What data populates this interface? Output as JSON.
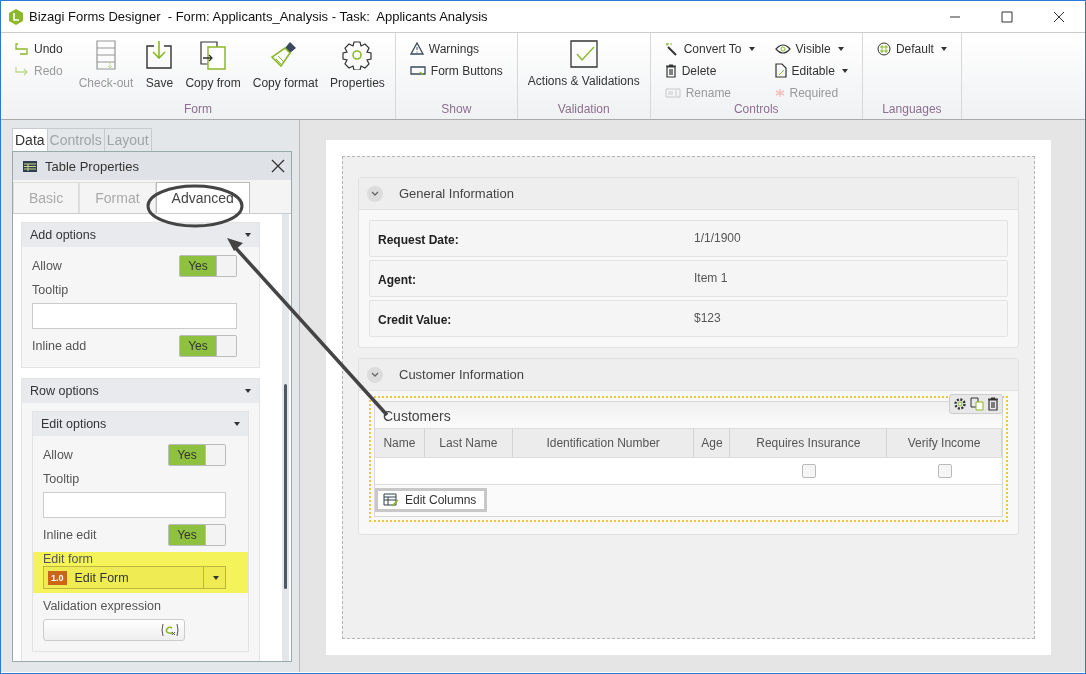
{
  "window": {
    "title": "Bizagi Forms Designer  - Form: Applicants_Analysis - Task:  Applicants Analysis"
  },
  "ribbon": {
    "groups": [
      {
        "label": "Form",
        "items": [
          {
            "kind": "small",
            "label": "Undo",
            "disabled": false,
            "dropdown": false
          },
          {
            "kind": "small",
            "label": "Redo",
            "disabled": true,
            "dropdown": false
          },
          {
            "kind": "large",
            "label": "Check-out",
            "disabled": true,
            "dropdown": false
          },
          {
            "kind": "large",
            "label": "Save",
            "disabled": false,
            "dropdown": false
          },
          {
            "kind": "large",
            "label": "Copy from",
            "disabled": false,
            "dropdown": false
          },
          {
            "kind": "large",
            "label": "Copy format",
            "disabled": false,
            "dropdown": false
          },
          {
            "kind": "large",
            "label": "Properties",
            "disabled": false,
            "dropdown": false
          }
        ]
      },
      {
        "label": "Show",
        "items": [
          {
            "kind": "small",
            "label": "Warnings",
            "disabled": false,
            "dropdown": false
          },
          {
            "kind": "small",
            "label": "Form Buttons",
            "disabled": false,
            "dropdown": false
          }
        ]
      },
      {
        "label": "Validation",
        "items": [
          {
            "kind": "large",
            "label": "Actions & Validations",
            "disabled": false,
            "dropdown": false
          }
        ]
      },
      {
        "label": "Controls",
        "items": [
          {
            "kind": "small",
            "label": "Convert To",
            "disabled": false,
            "dropdown": true
          },
          {
            "kind": "small",
            "label": "Delete",
            "disabled": false,
            "dropdown": false
          },
          {
            "kind": "small",
            "label": "Rename",
            "disabled": true,
            "dropdown": false
          },
          {
            "kind": "small",
            "label": "Visible",
            "disabled": false,
            "dropdown": true
          },
          {
            "kind": "small",
            "label": "Editable",
            "disabled": false,
            "dropdown": true
          },
          {
            "kind": "small",
            "label": "Required",
            "disabled": true,
            "dropdown": false
          }
        ]
      },
      {
        "label": "Languages",
        "items": [
          {
            "kind": "small",
            "label": "Default",
            "disabled": false,
            "dropdown": true
          }
        ]
      }
    ]
  },
  "side_panel": {
    "tabs": [
      {
        "label": "Data",
        "selected": true
      },
      {
        "label": "Controls",
        "selected": false
      },
      {
        "label": "Layout",
        "selected": false
      }
    ],
    "properties": {
      "title": "Table Properties",
      "tabs": [
        {
          "label": "Basic",
          "selected": false
        },
        {
          "label": "Format",
          "selected": false
        },
        {
          "label": "Advanced",
          "selected": true
        }
      ],
      "sections": [
        {
          "title": "Add options",
          "fields": [
            {
              "kind": "toggle",
              "label": "Allow",
              "value": "Yes",
              "on": true
            },
            {
              "kind": "text",
              "label": "Tooltip"
            },
            {
              "kind": "toggle",
              "label": "Inline add",
              "value": "Yes",
              "on": true
            }
          ]
        },
        {
          "title": "Row options",
          "subsections": [
            {
              "title": "Edit options",
              "fields": [
                {
                  "kind": "toggle",
                  "label": "Allow",
                  "value": "Yes",
                  "on": true
                },
                {
                  "kind": "text",
                  "label": "Tooltip"
                },
                {
                  "kind": "toggle",
                  "label": "Inline edit",
                  "value": "Yes",
                  "on": true
                },
                {
                  "kind": "select",
                  "label": "Edit form",
                  "badge": "1.0",
                  "value": "Edit Form",
                  "highlighted": true
                },
                {
                  "kind": "expression",
                  "label": "Validation expression"
                }
              ]
            }
          ]
        }
      ]
    }
  },
  "form": {
    "sections": [
      {
        "title": "General Information",
        "fields": [
          {
            "label": "Request Date:",
            "value": "1/1/1900"
          },
          {
            "label": "Agent:",
            "value": "Item 1"
          },
          {
            "label": "Credit Value:",
            "value": "$123"
          }
        ]
      },
      {
        "title": "Customer Information",
        "table": {
          "title": "Customers",
          "columns": [
            {
              "label": "Name",
              "kind": "text"
            },
            {
              "label": "Last Name",
              "kind": "text"
            },
            {
              "label": "Identification Number",
              "kind": "text"
            },
            {
              "label": "Age",
              "kind": "text"
            },
            {
              "label": "Requires Insurance",
              "kind": "checkbox"
            },
            {
              "label": "Verify Income",
              "kind": "checkbox"
            }
          ],
          "rows": [
            {
              "cells": [
                {
                  "checked": false
                },
                {
                  "checked": false
                }
              ]
            }
          ],
          "button": "Edit Columns"
        }
      }
    ]
  }
}
